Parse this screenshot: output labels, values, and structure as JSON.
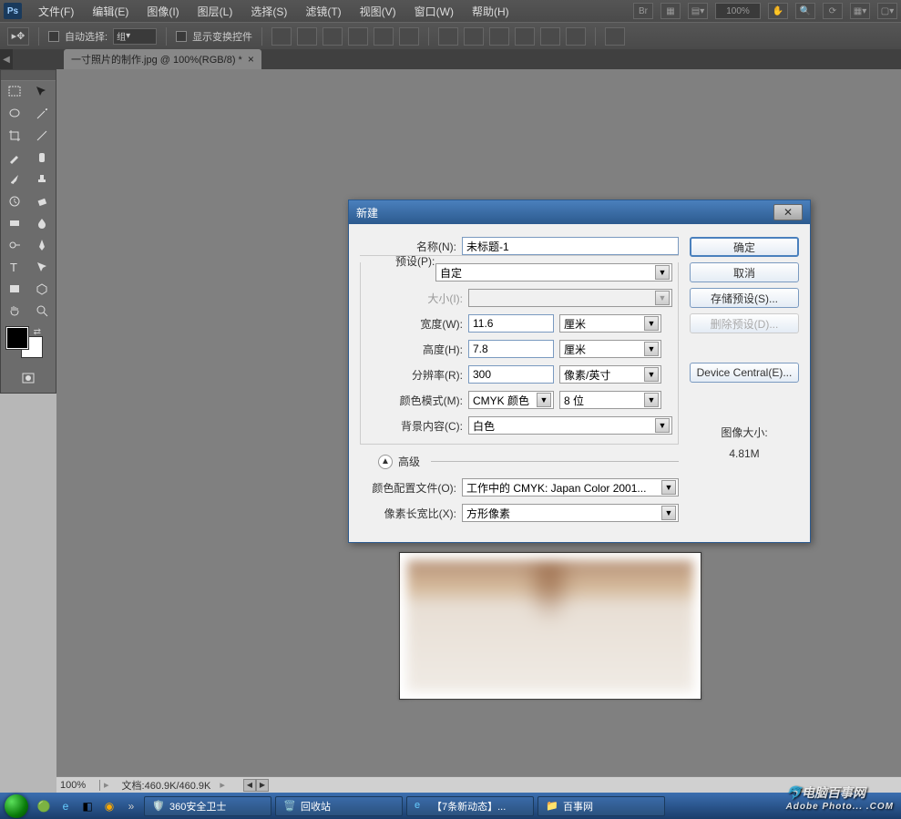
{
  "menubar": {
    "items": [
      "文件(F)",
      "编辑(E)",
      "图像(I)",
      "图层(L)",
      "选择(S)",
      "滤镜(T)",
      "视图(V)",
      "窗口(W)",
      "帮助(H)"
    ],
    "zoom": "100%"
  },
  "optionsbar": {
    "auto_select_label": "自动选择:",
    "group_select": "组",
    "show_transform_label": "显示变换控件"
  },
  "tab": {
    "title": "一寸照片的制作.jpg @ 100%(RGB/8) *"
  },
  "statusbar": {
    "zoom": "100%",
    "doc_info": "文档:460.9K/460.9K"
  },
  "dialog": {
    "title": "新建",
    "name_label": "名称(N):",
    "name_value": "未标题-1",
    "preset_label": "预设(P):",
    "preset_value": "自定",
    "size_label": "大小(I):",
    "width_label": "宽度(W):",
    "width_value": "11.6",
    "width_unit": "厘米",
    "height_label": "高度(H):",
    "height_value": "7.8",
    "height_unit": "厘米",
    "res_label": "分辨率(R):",
    "res_value": "300",
    "res_unit": "像素/英寸",
    "mode_label": "颜色模式(M):",
    "mode_value": "CMYK 颜色",
    "depth_value": "8 位",
    "bg_label": "背景内容(C):",
    "bg_value": "白色",
    "advanced_label": "高级",
    "profile_label": "颜色配置文件(O):",
    "profile_value": "工作中的 CMYK: Japan Color 2001...",
    "aspect_label": "像素长宽比(X):",
    "aspect_value": "方形像素",
    "ok": "确定",
    "cancel": "取消",
    "save_preset": "存储预设(S)...",
    "delete_preset": "删除预设(D)...",
    "device_central": "Device Central(E)...",
    "image_size_label": "图像大小:",
    "image_size_value": "4.81M"
  },
  "taskbar": {
    "items": [
      "360安全卫士",
      "回收站",
      "【7条新动态】...",
      "百事网"
    ]
  },
  "watermark": {
    "main": "电脑百事网",
    "sub": "Adobe Photo... .COM"
  }
}
